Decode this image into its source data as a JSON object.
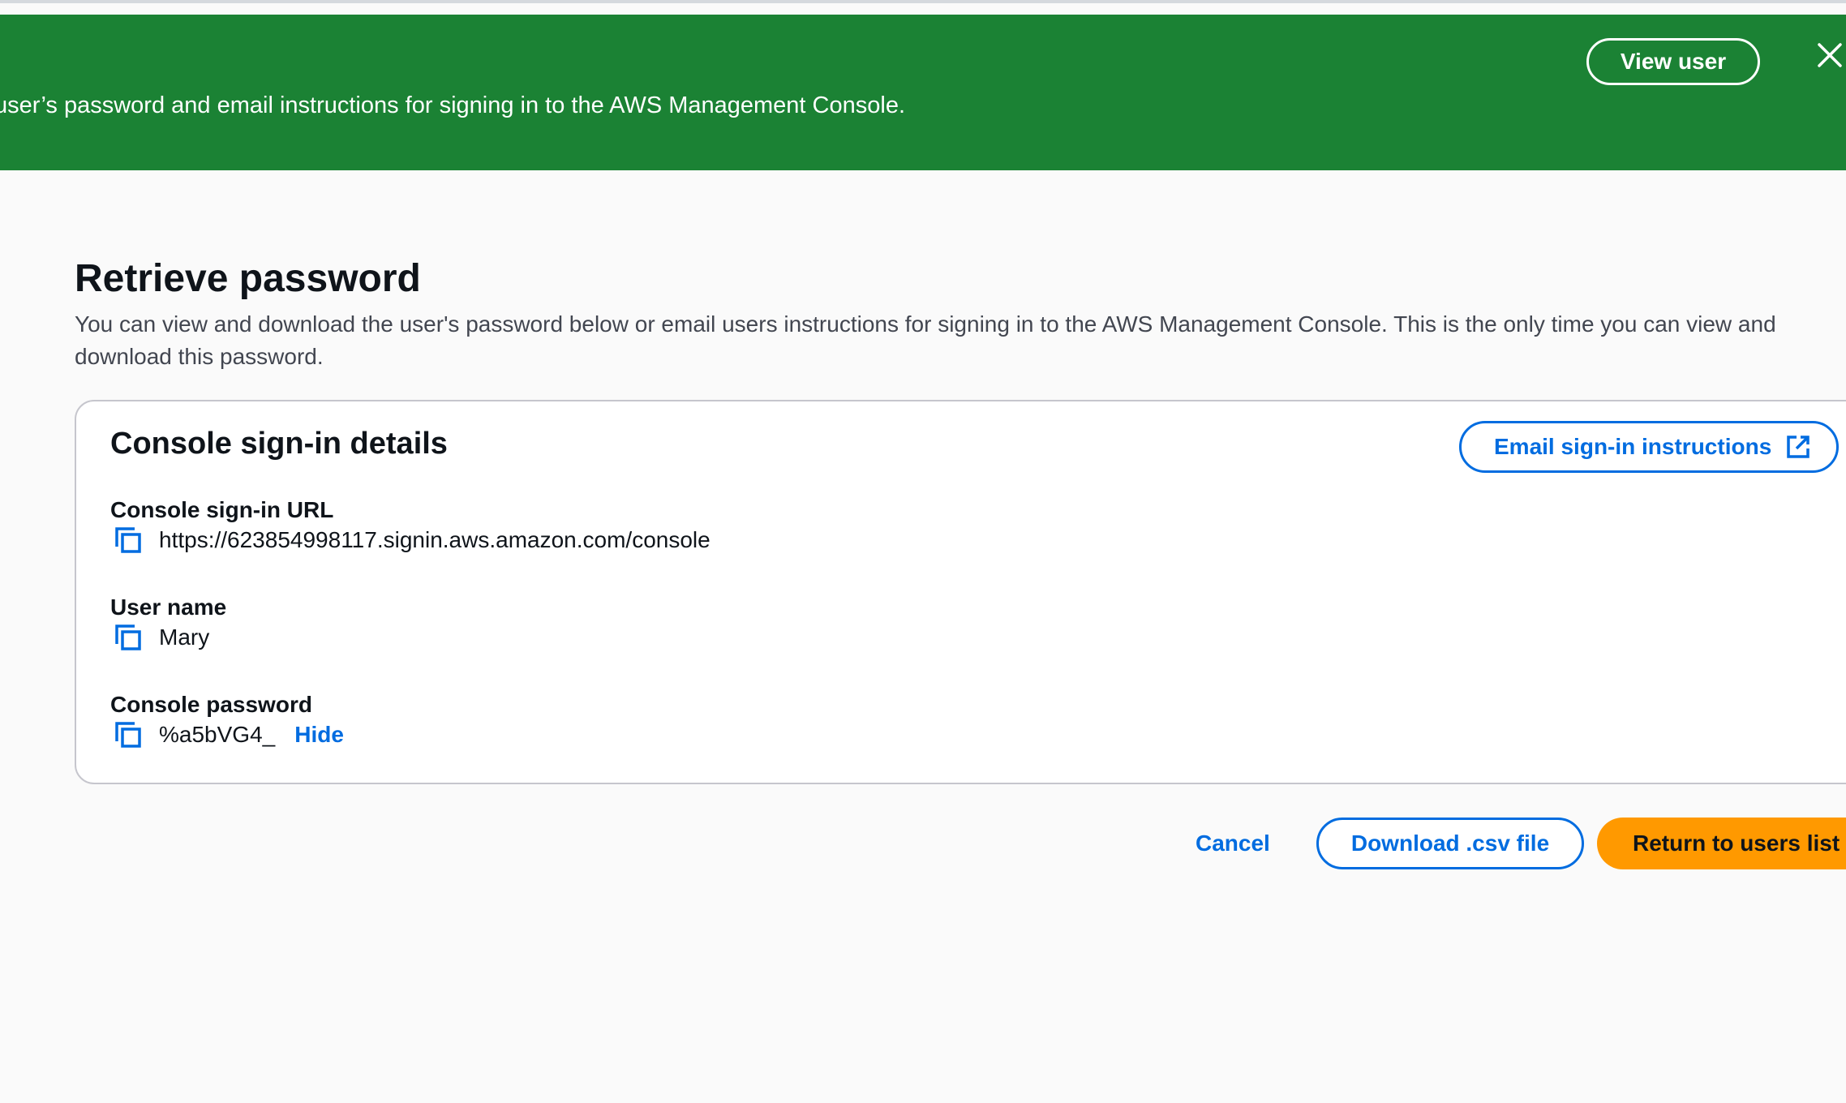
{
  "flash": {
    "message": "e user’s password and email instructions for signing in to the AWS Management Console.",
    "view_user_label": "View user",
    "close_icon": "close-icon",
    "background_color": "#1b8234"
  },
  "page": {
    "title": "Retrieve password",
    "description": "You can view and download the user's password below or email users instructions for signing in to the AWS Management Console. This is the only time you can view and download this password."
  },
  "card": {
    "title": "Console sign-in details",
    "email_button_label": "Email sign-in instructions",
    "email_button_icon": "external-link-icon",
    "fields": {
      "url": {
        "label": "Console sign-in URL",
        "value": "https://623854998117.signin.aws.amazon.com/console",
        "icon": "copy-icon"
      },
      "username": {
        "label": "User name",
        "value": "Mary",
        "icon": "copy-icon"
      },
      "password": {
        "label": "Console password",
        "value": "%a5bVG4_",
        "toggle_label": "Hide",
        "icon": "copy-icon"
      }
    }
  },
  "actions": {
    "cancel_label": "Cancel",
    "download_label": "Download .csv file",
    "return_label": "Return to users list"
  },
  "colors": {
    "link_blue": "#006ce0",
    "primary_orange": "#ff9900",
    "text_dark": "#0f141a",
    "text_secondary": "#424650"
  }
}
